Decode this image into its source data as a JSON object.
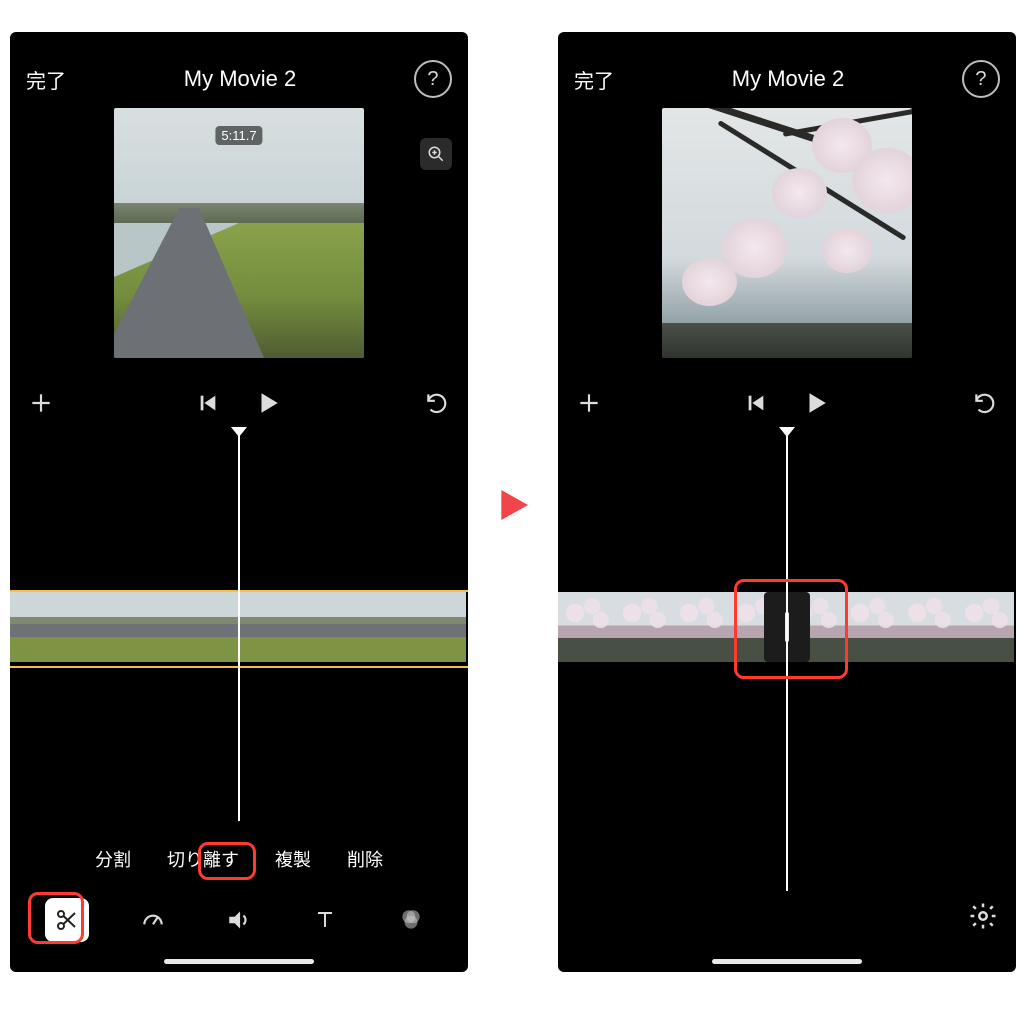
{
  "left": {
    "header": {
      "done": "完了",
      "title": "My Movie 2",
      "help": "?"
    },
    "preview_time": "5:11.7",
    "actions": {
      "split": "分割",
      "detach": "切り離す",
      "duplicate": "複製",
      "delete": "削除"
    }
  },
  "right": {
    "header": {
      "done": "完了",
      "title": "My Movie 2",
      "help": "?"
    }
  },
  "icons": {
    "add": "add",
    "skip_back": "skip-back",
    "play": "play",
    "undo": "undo",
    "zoom": "zoom",
    "scissors": "scissors",
    "speed": "speedometer",
    "volume": "volume",
    "text": "text",
    "filters": "filters",
    "gear": "gear"
  }
}
